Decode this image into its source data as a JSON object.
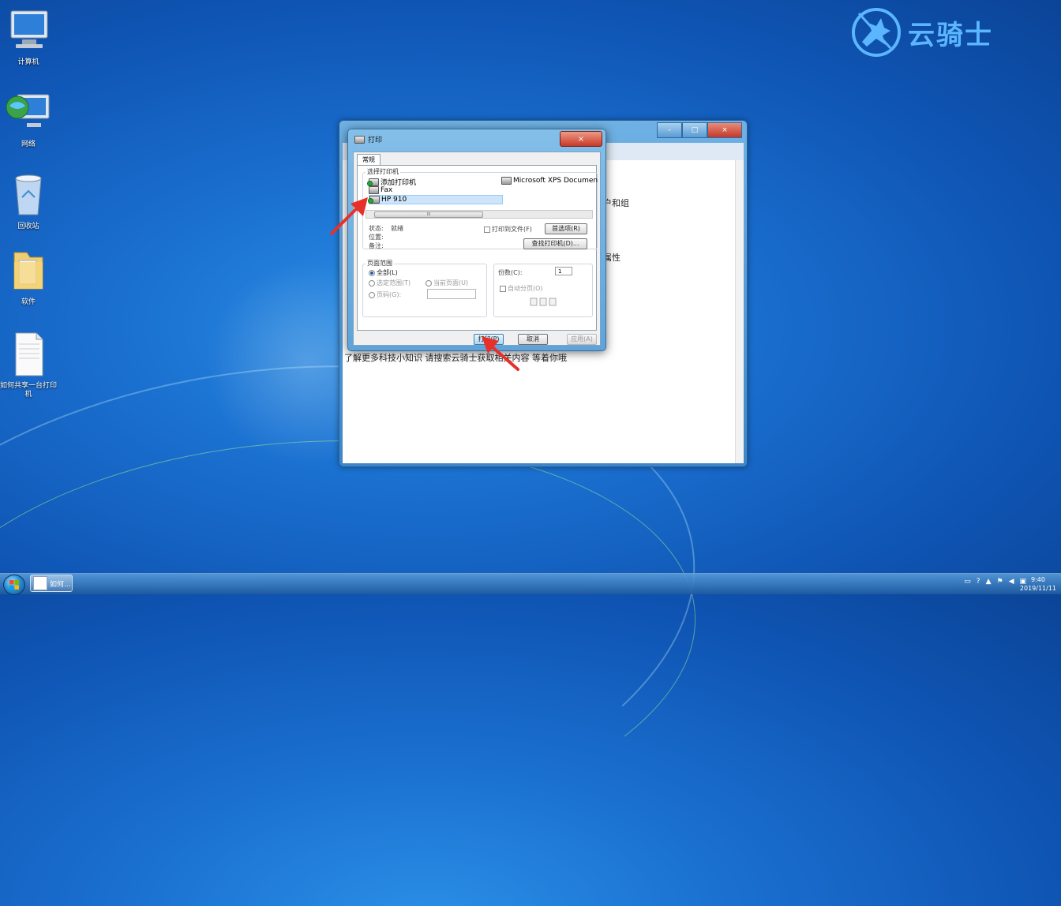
{
  "logo": {
    "text": "云骑士"
  },
  "desktop_icons": [
    {
      "label": "计算机"
    },
    {
      "label": "网络"
    },
    {
      "label": "回收站"
    },
    {
      "label": "软件"
    },
    {
      "label": "如何共享一台打印机"
    }
  ],
  "background_window": {
    "controls": {
      "minimize": "–",
      "maximize": "□",
      "close": "×"
    },
    "fragments": [
      "户和组",
      "属性"
    ],
    "footer_line": "了解更多科技小知识   请搜索云骑士获取相关内容   等着你哦"
  },
  "print_dialog": {
    "title": "打印",
    "close": "×",
    "tab": "常规",
    "select_printer_label": "选择打印机",
    "printers": [
      {
        "name": "添加打印机",
        "selected": false
      },
      {
        "name": "Microsoft XPS Documen",
        "selected": false
      },
      {
        "name": "Fax",
        "selected": false
      },
      {
        "name": "HP 910",
        "selected": true
      }
    ],
    "scroll_thumb": "III",
    "status_label": "状态:",
    "status_value": "就绪",
    "location_label": "位置:",
    "comment_label": "备注:",
    "print_to_file": "打印到文件(F)",
    "preferences_button": "首选项(R)",
    "find_printer_button": "查找打印机(D)...",
    "page_range_label": "页面范围",
    "range_all": "全部(L)",
    "range_selection": "选定范围(T)",
    "range_current": "当前页面(U)",
    "range_pages": "页码(G):",
    "copies_label": "份数(C):",
    "copies_value": "1",
    "collate": "自动分页(O)",
    "print_button": "打印(P)",
    "cancel_button": "取消",
    "apply_button": "应用(A)"
  },
  "taskbar": {
    "task_label": "如何...",
    "time": "9:40",
    "date": "2019/11/11"
  },
  "colors": {
    "desktop": "#1a6fcf",
    "dialog_frame": "#5ea3d9",
    "selected_row": "#cde5fb",
    "arrow": "#e8302a"
  }
}
